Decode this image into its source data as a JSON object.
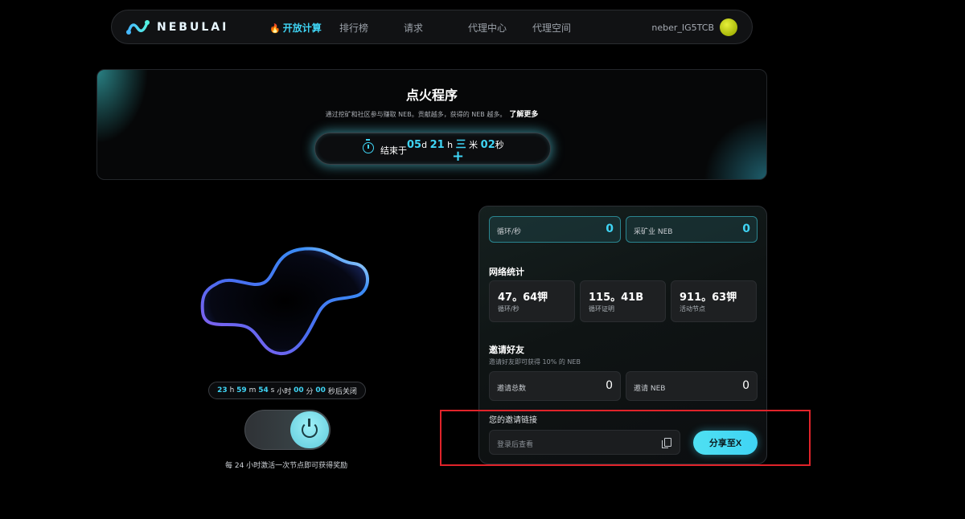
{
  "brand": {
    "name": "NEBULAI"
  },
  "nav": {
    "items": [
      {
        "label": "开放计算",
        "active": true
      },
      {
        "label": "排行榜"
      },
      {
        "label": "请求"
      },
      {
        "label": "代理中心"
      },
      {
        "label": "代理空间"
      }
    ],
    "username": "neber_IG5TCB"
  },
  "banner": {
    "title": "点火程序",
    "subtitle": "通过挖矿和社区参与赚取 NEB。贡献越多，获得的 NEB 越多。",
    "learn_more": "了解更多",
    "countdown_label": "结束于",
    "days": "05",
    "days_unit": "d",
    "hours": "21",
    "hours_unit": "h",
    "mid": "三",
    "mid_unit": "米",
    "seconds": "02",
    "seconds_unit": "秒",
    "plus": "+"
  },
  "node": {
    "timer": {
      "h": "23",
      "h_unit": "h",
      "m": "59",
      "m_unit": "m",
      "s": "54",
      "s_unit": "s",
      "hours_label": "小时",
      "min": "00",
      "min_label": "分",
      "sec": "00",
      "sec_label": "秒后关闭"
    },
    "note": "每 24 小时激活一次节点即可获得奖励"
  },
  "stats": {
    "cycles_label": "循环/秒",
    "cycles_value": "0",
    "mined_label": "采矿业 NEB",
    "mined_value": "0",
    "network_title": "网络统计",
    "network": [
      {
        "value": "47。64钾",
        "label": "循环/秒"
      },
      {
        "value": "115。41B",
        "label": "循环证明"
      },
      {
        "value": "911。63钾",
        "label": "活动节点"
      }
    ]
  },
  "invite": {
    "title": "邀请好友",
    "subtitle": "邀请好友即可获得 10% 的 NEB",
    "total_label": "邀请总数",
    "total_value": "0",
    "neb_label": "邀请 NEB",
    "neb_value": "0",
    "link_label": "您的邀请链接",
    "link_placeholder": "登录后查看",
    "share_label": "分享至X"
  },
  "colors": {
    "accent": "#3fd4f4",
    "highlight": "#e0232a"
  }
}
